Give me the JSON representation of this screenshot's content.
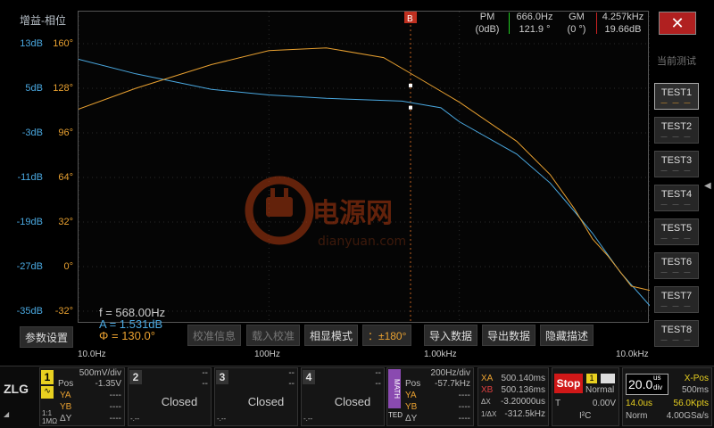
{
  "plot": {
    "title": "增益-相位",
    "db_ticks": [
      "13dB",
      "5dB",
      "-3dB",
      "-11dB",
      "-19dB",
      "-27dB",
      "-35dB"
    ],
    "deg_ticks": [
      "160°",
      "128°",
      "96°",
      "64°",
      "32°",
      "0°",
      "-32°"
    ],
    "x_ticks": [
      "10.0Hz",
      "100Hz",
      "1.00kHz",
      "10.0kHz"
    ],
    "cursor_marker": "B",
    "pm_label": "PM",
    "pm_sub": "(0dB)",
    "pm_freq": "666.0Hz",
    "pm_value": "121.9 °",
    "gm_label": "GM",
    "gm_sub": "(0 °)",
    "gm_freq": "4.257kHz",
    "gm_value": "19.66dB",
    "watermark_text": "电源网",
    "watermark_sub": "dianyuan.com"
  },
  "readout": {
    "f": "f = 568.00Hz",
    "a": "A = 1.531dB",
    "phi": "Φ = 130.0°"
  },
  "colors": {
    "gain": "#4aa8e0",
    "phase": "#e8a030",
    "accent": "#b02020"
  },
  "chart_data": {
    "type": "line",
    "xlabel": "",
    "ylabel": "",
    "x_scale": "log",
    "xlim": [
      10,
      10000
    ],
    "ylim_gain_db": [
      -35,
      13
    ],
    "ylim_phase_deg": [
      -32,
      160
    ],
    "series": [
      {
        "axis": "gain",
        "x": [
          10,
          20,
          50,
          100,
          200,
          500,
          800,
          1000,
          2000,
          3000,
          4000,
          5000,
          7000,
          10000
        ],
        "values": [
          10.2,
          7.6,
          4.8,
          3.8,
          3.2,
          2.7,
          1.5,
          -1.0,
          -6.8,
          -12.0,
          -17.0,
          -21.0,
          -28.0,
          -34.0
        ]
      },
      {
        "axis": "phase",
        "x": [
          10,
          20,
          50,
          100,
          200,
          400,
          600,
          1000,
          2000,
          3000,
          4000,
          5000,
          6000,
          8000,
          10000
        ],
        "values": [
          113,
          128,
          145,
          155,
          157,
          150,
          136,
          118,
          90,
          66,
          42,
          20,
          8,
          -14,
          -17
        ]
      }
    ]
  },
  "toolbar": {
    "btn_calib_info": "校准信息",
    "btn_load_calib": "载入校准",
    "btn_phase_mode": "相显模式",
    "btn_phase_range": "：±180°",
    "btn_import": "导入数据",
    "btn_export": "导出数据",
    "btn_hide_desc": "隐藏描述",
    "btn_settings": "参数设置"
  },
  "sidebar": {
    "close_symbol": "✕",
    "current_label": "当前测试",
    "tests": [
      "TEST1",
      "TEST2",
      "TEST3",
      "TEST4",
      "TEST5",
      "TEST6",
      "TEST7",
      "TEST8"
    ],
    "dash_marks": "— — —"
  },
  "bottom": {
    "logo": "ZLG",
    "ch1": {
      "num": "1",
      "scale": "500mV/div",
      "pos_label": "Pos",
      "pos": "-1.35V",
      "ya": "YA",
      "yb": "YB",
      "dy": "ΔY",
      "ya_val": "----",
      "yb_val": "----",
      "dy_val": "----",
      "coupling": "1:1",
      "imp": "1MΩ"
    },
    "ch2": {
      "num": "2",
      "scale": "--",
      "pos": "--",
      "status": "Closed",
      "dash": "-.--"
    },
    "ch3": {
      "num": "3",
      "scale": "--",
      "pos": "--",
      "status": "Closed",
      "dash": "-.--"
    },
    "ch4": {
      "num": "4",
      "scale": "--",
      "pos": "--",
      "status": "Closed",
      "dash": "-.--"
    },
    "math": {
      "label": "MATH",
      "scale": "200Hz/div",
      "pos_label": "Pos",
      "pos": "-57.7kHz",
      "ya": "YA",
      "yb": "YB",
      "dy": "ΔY",
      "ya_val": "----",
      "yb_val": "----",
      "dy_val": "----",
      "tag": "TED"
    },
    "cursor": {
      "xa_label": "XA",
      "xa": "500.140ms",
      "xb_label": "XB",
      "xb": "500.136ms",
      "dx_label": "ΔX",
      "dx": "-3.20000us",
      "inv_label": "1/ΔX",
      "inv": "-312.5kHz"
    },
    "trigger": {
      "stop": "Stop",
      "ch": "1",
      "mode": "Normal",
      "t_label": "T",
      "level": "0.00V",
      "bus": "I²C"
    },
    "timebase": {
      "scale": "20.0",
      "unit_top": "us",
      "unit_bottom": "div",
      "xpos_label": "X-Pos",
      "xpos": "500ms",
      "delay": "14.0us",
      "pts": "56.0Kpts",
      "acq": "Norm",
      "rate": "4.00GSa/s"
    }
  }
}
